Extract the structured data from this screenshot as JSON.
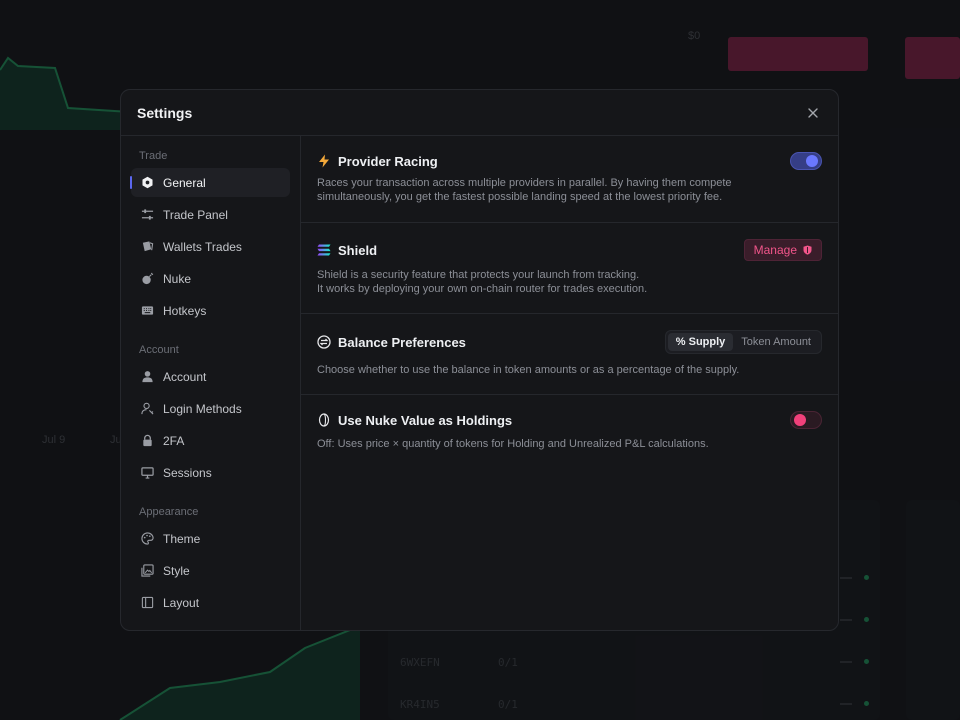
{
  "background": {
    "price_label": "$0",
    "date_labels": [
      "Jul 9",
      "Ju"
    ],
    "rows": [
      {
        "code": "6WXEFN",
        "ratio": "0/1"
      },
      {
        "code": "KR4IN5",
        "ratio": "0/1"
      }
    ]
  },
  "modal": {
    "title": "Settings",
    "close_icon": "close-icon"
  },
  "sidebar": {
    "groups": [
      {
        "label": "Trade",
        "items": [
          {
            "label": "General",
            "icon": "hexagon-gear-icon",
            "active": true
          },
          {
            "label": "Trade Panel",
            "icon": "sliders-icon"
          },
          {
            "label": "Wallets Trades",
            "icon": "wallet-cards-icon"
          },
          {
            "label": "Nuke",
            "icon": "bomb-icon"
          },
          {
            "label": "Hotkeys",
            "icon": "keyboard-icon"
          }
        ]
      },
      {
        "label": "Account",
        "items": [
          {
            "label": "Account",
            "icon": "user-icon"
          },
          {
            "label": "Login Methods",
            "icon": "user-key-icon"
          },
          {
            "label": "2FA",
            "icon": "lock-icon"
          },
          {
            "label": "Sessions",
            "icon": "monitor-icon"
          }
        ]
      },
      {
        "label": "Appearance",
        "items": [
          {
            "label": "Theme",
            "icon": "palette-icon"
          },
          {
            "label": "Style",
            "icon": "image-style-icon"
          },
          {
            "label": "Layout",
            "icon": "layout-sidebar-icon"
          }
        ]
      }
    ]
  },
  "sections": {
    "provider_racing": {
      "title": "Provider Racing",
      "icon": "lightning-icon",
      "description": "Races your transaction across multiple providers in parallel. By having them compete simultaneously, you get the fastest possible landing speed at the lowest priority fee.",
      "toggle_on": true
    },
    "shield": {
      "title": "Shield",
      "icon": "solana-stack-icon",
      "description_line1": "Shield is a security feature that protects your launch from tracking.",
      "description_line2": "It works by deploying your own on-chain router for trades execution.",
      "button_label": "Manage"
    },
    "balance_preferences": {
      "title": "Balance Preferences",
      "icon": "balance-swap-icon",
      "description": "Choose whether to use the balance in token amounts or as a percentage of the supply.",
      "options": [
        "% Supply",
        "Token Amount"
      ],
      "selected": "% Supply"
    },
    "nuke_value": {
      "title": "Use Nuke Value as Holdings",
      "icon": "coin-icon",
      "description": "Off: Uses price × quantity of tokens for Holding and Unrealized P&L calculations.",
      "toggle_on": false
    }
  },
  "colors": {
    "accent": "#5b67f0",
    "danger": "#f0407a",
    "chart_green": "#1f8a57",
    "sell_pill": "#7a1f42"
  }
}
